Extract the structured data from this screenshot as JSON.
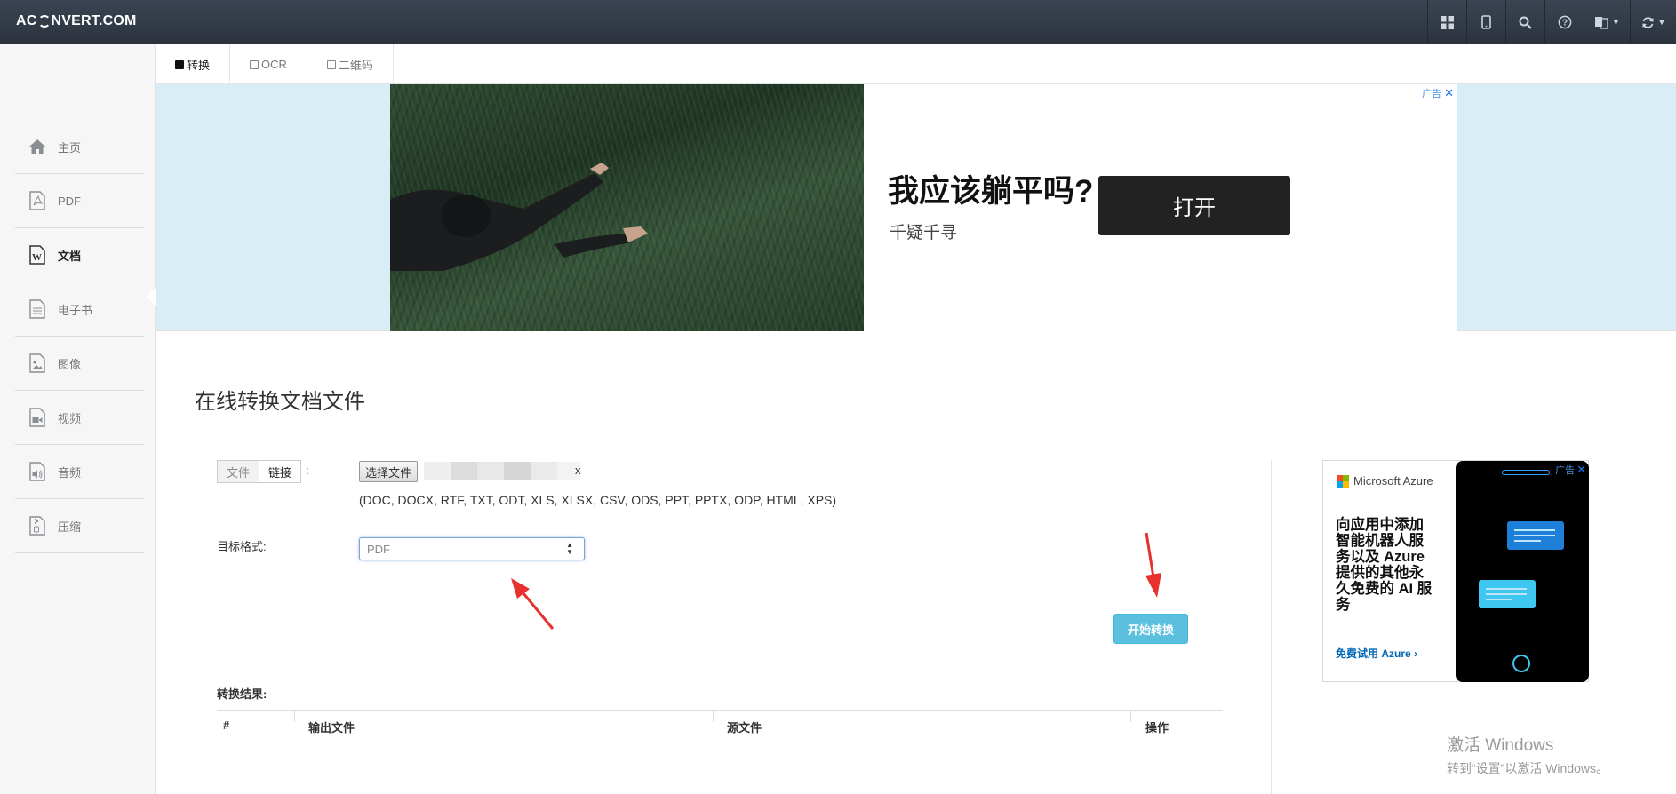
{
  "brand": {
    "prefix": "AC",
    "suffix": "NVERT.COM"
  },
  "navbar": {
    "icons": [
      "grid-icon",
      "tablet-icon",
      "search-icon",
      "help-icon",
      "translate-icon",
      "refresh-icon"
    ]
  },
  "tabs": [
    {
      "label": "转换",
      "active": true
    },
    {
      "label": "OCR",
      "active": false
    },
    {
      "label": "二维码",
      "active": false
    }
  ],
  "sidebar": {
    "items": [
      {
        "label": "主页",
        "icon": "home-icon",
        "active": false
      },
      {
        "label": "PDF",
        "icon": "pdf-icon",
        "active": false
      },
      {
        "label": "文档",
        "icon": "word-document-icon",
        "active": true
      },
      {
        "label": "电子书",
        "icon": "ebook-icon",
        "active": false
      },
      {
        "label": "图像",
        "icon": "image-icon",
        "active": false
      },
      {
        "label": "视频",
        "icon": "video-icon",
        "active": false
      },
      {
        "label": "音频",
        "icon": "audio-icon",
        "active": false
      },
      {
        "label": "压缩",
        "icon": "archive-icon",
        "active": false
      }
    ]
  },
  "ad_banner": {
    "tag": "广告",
    "headline": "我应该躺平吗?",
    "subtitle": "千疑千寻",
    "button": "打开"
  },
  "main": {
    "title": "在线转换文档文件",
    "source_toggle": {
      "file": "文件",
      "link": "链接",
      "colon": ":"
    },
    "choose_file": "选择文件",
    "file_ext_visible": "x",
    "formats": "(DOC, DOCX, RTF, TXT, ODT, XLS, XLSX, CSV, ODS, PPT, PPTX, ODP, HTML, XPS)",
    "target_label": "目标格式:",
    "target_value": "PDF",
    "convert_button": "开始转换",
    "result_label": "转换结果:",
    "table_headers": [
      "#",
      "输出文件",
      "源文件",
      "操作"
    ]
  },
  "side_ad": {
    "brand": "Microsoft Azure",
    "tag": "广告",
    "text": "向应用中添加智能机器人服务以及 Azure 提供的其他永久免费的 AI 服务",
    "link": "免费试用 Azure ›"
  },
  "watermark": {
    "line1": "激活 Windows",
    "line2": "转到“设置”以激活 Windows。"
  },
  "colors": {
    "navbar": "#2c333d",
    "convert_button": "#5bc0de",
    "ad_band": "#d9edf6",
    "arrow": "#e8312f"
  }
}
